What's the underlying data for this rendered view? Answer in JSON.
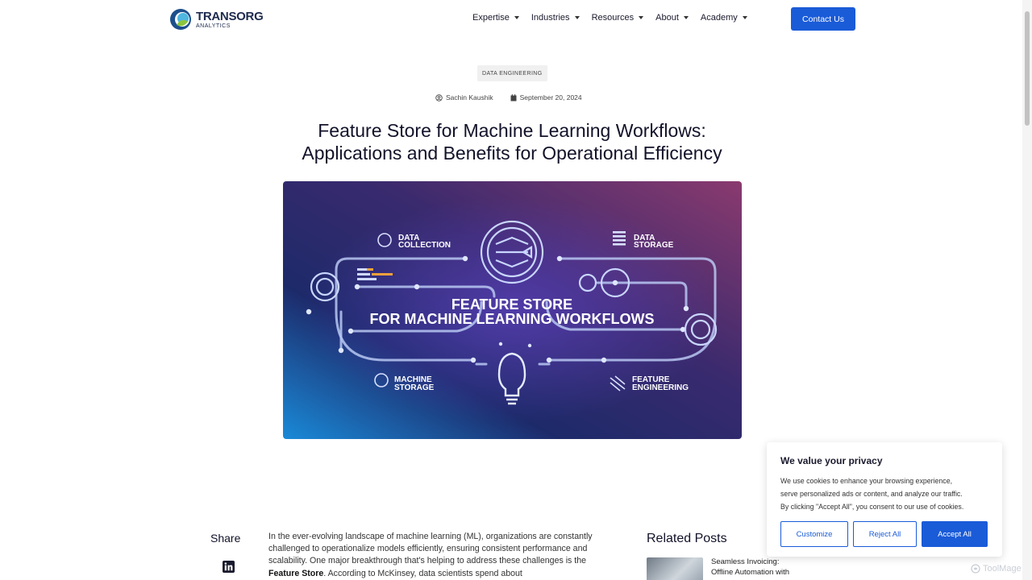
{
  "header": {
    "logo_title": "TRANSORG",
    "logo_subtitle": "ANALYTICS",
    "nav": [
      {
        "label": "Expertise"
      },
      {
        "label": "Industries"
      },
      {
        "label": "Resources"
      },
      {
        "label": "About"
      },
      {
        "label": "Academy"
      }
    ],
    "contact_label": "Contact Us"
  },
  "article": {
    "category": "DATA ENGINEERING",
    "author": "Sachin Kaushik",
    "date": "September 20, 2024",
    "title_line1": "Feature Store for Machine Learning Workflows:",
    "title_line2": "Applications and Benefits for Operational Efficiency",
    "hero": {
      "headline_line1": "FEATURE STORE",
      "headline_line2": "FOR MACHINE LEARNING WORKFLOWS",
      "label_data_collection_1": "DATA",
      "label_data_collection_2": "COLLECTION",
      "label_data_storage_1": "DATA",
      "label_data_storage_2": "STORAGE",
      "label_machine_storage_1": "MACHINE",
      "label_machine_storage_2": "STORAGE",
      "label_feature_engineering_1": "FEATURE",
      "label_feature_engineering_2": "ENGINEERING"
    },
    "body_before_bold": "In the ever-evolving landscape of machine learning (ML), organizations are constantly challenged to operationalize models efficiently, ensuring consistent performance and scalability. One major breakthrough that's helping to address these challenges is the ",
    "body_bold": "Feature Store",
    "body_after_bold": ". According to McKinsey, data scientists spend about"
  },
  "share": {
    "label": "Share",
    "icon": "linkedin-icon"
  },
  "related": {
    "title": "Related Posts",
    "posts": [
      {
        "title_line1": "Seamless Invoicing:",
        "title_line2": "Offline Automation with"
      }
    ]
  },
  "cookie": {
    "title": "We value your privacy",
    "text_line1": "We use cookies to enhance your browsing experience,",
    "text_line2": "serve personalized ads or content, and analyze our traffic.",
    "text_line3": "By clicking \"Accept All\", you consent to our use of cookies.",
    "customize_label": "Customize",
    "reject_label": "Reject All",
    "accept_label": "Accept All"
  },
  "watermark": "ToolMage",
  "colors": {
    "accent": "#1a5bd8",
    "title": "#12122a"
  }
}
